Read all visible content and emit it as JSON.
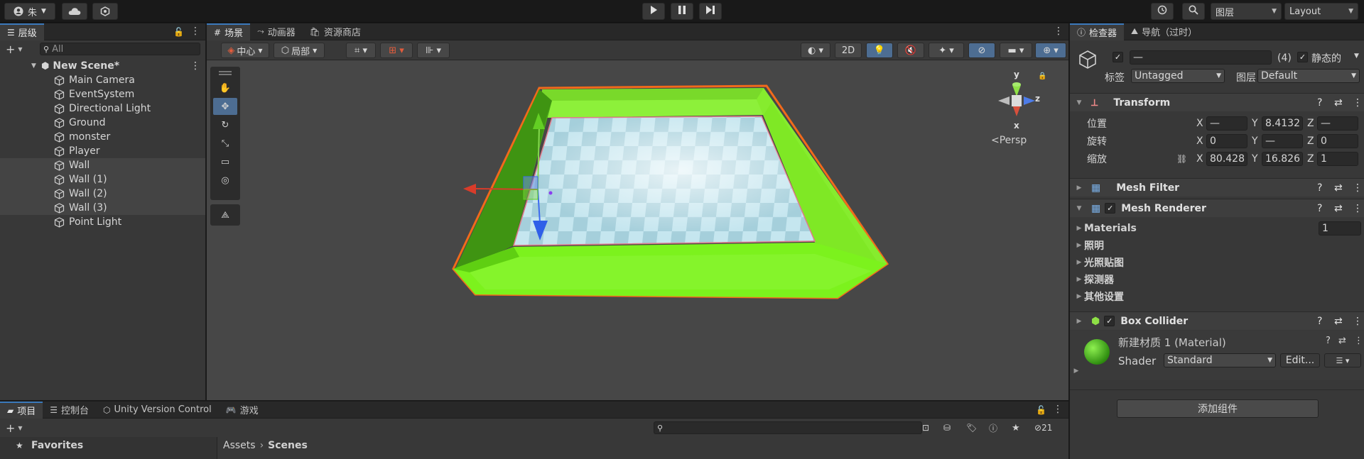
{
  "toolbar": {
    "account_label": "朱",
    "layers_label": "图层",
    "layout_label": "Layout"
  },
  "hierarchy": {
    "tab": "层级",
    "search_placeholder": "All",
    "scene_name": "New Scene*",
    "items": [
      {
        "label": "Main Camera"
      },
      {
        "label": "EventSystem"
      },
      {
        "label": "Directional Light"
      },
      {
        "label": "Ground"
      },
      {
        "label": "monster"
      },
      {
        "label": "Player"
      },
      {
        "label": "Wall"
      },
      {
        "label": "Wall (1)"
      },
      {
        "label": "Wall (2)"
      },
      {
        "label": "Wall (3)"
      },
      {
        "label": "Point Light"
      }
    ]
  },
  "scene": {
    "tabs": [
      "场景",
      "动画器",
      "资源商店"
    ],
    "pivot_label": "中心",
    "space_label": "局部",
    "mode_2d": "2D",
    "gizmo": {
      "x": "x",
      "y": "y",
      "z": "z",
      "persp": "Persp"
    }
  },
  "inspector": {
    "tabs": [
      "检查器",
      "导航（过时）"
    ],
    "object_name": "—",
    "count": "(4)",
    "static_label": "静态的",
    "tag_label": "标签",
    "tag_value": "Untagged",
    "layer_label": "图层",
    "layer_value": "Default",
    "transform": {
      "title": "Transform",
      "position_label": "位置",
      "rotation_label": "旋转",
      "scale_label": "缩放",
      "axis_x": "X",
      "axis_y": "Y",
      "axis_z": "Z",
      "position": [
        "—",
        "8.4132",
        "—"
      ],
      "rotation": [
        "0",
        "—",
        "0"
      ],
      "scale": [
        "80.428",
        "16.826",
        "1"
      ]
    },
    "mesh_filter": "Mesh Filter",
    "mesh_renderer": {
      "title": "Mesh Renderer",
      "materials_label": "Materials",
      "materials_count": "1",
      "sections": [
        "照明",
        "光照贴图",
        "探测器",
        "其他设置"
      ]
    },
    "box_collider": "Box Collider",
    "material": {
      "name": "新建材质 1 (Material)",
      "shader_label": "Shader",
      "shader_value": "Standard",
      "edit_label": "Edit..."
    },
    "add_component": "添加组件"
  },
  "project": {
    "tabs": [
      "项目",
      "控制台",
      "Unity Version Control",
      "游戏"
    ],
    "favorites": "Favorites",
    "breadcrumb": [
      "Assets",
      "Scenes"
    ],
    "hidden_count": "21"
  },
  "colors": {
    "accent": "#3a79bb",
    "wall_green": "#7cf21d",
    "selection_outline": "#f26a1b"
  }
}
